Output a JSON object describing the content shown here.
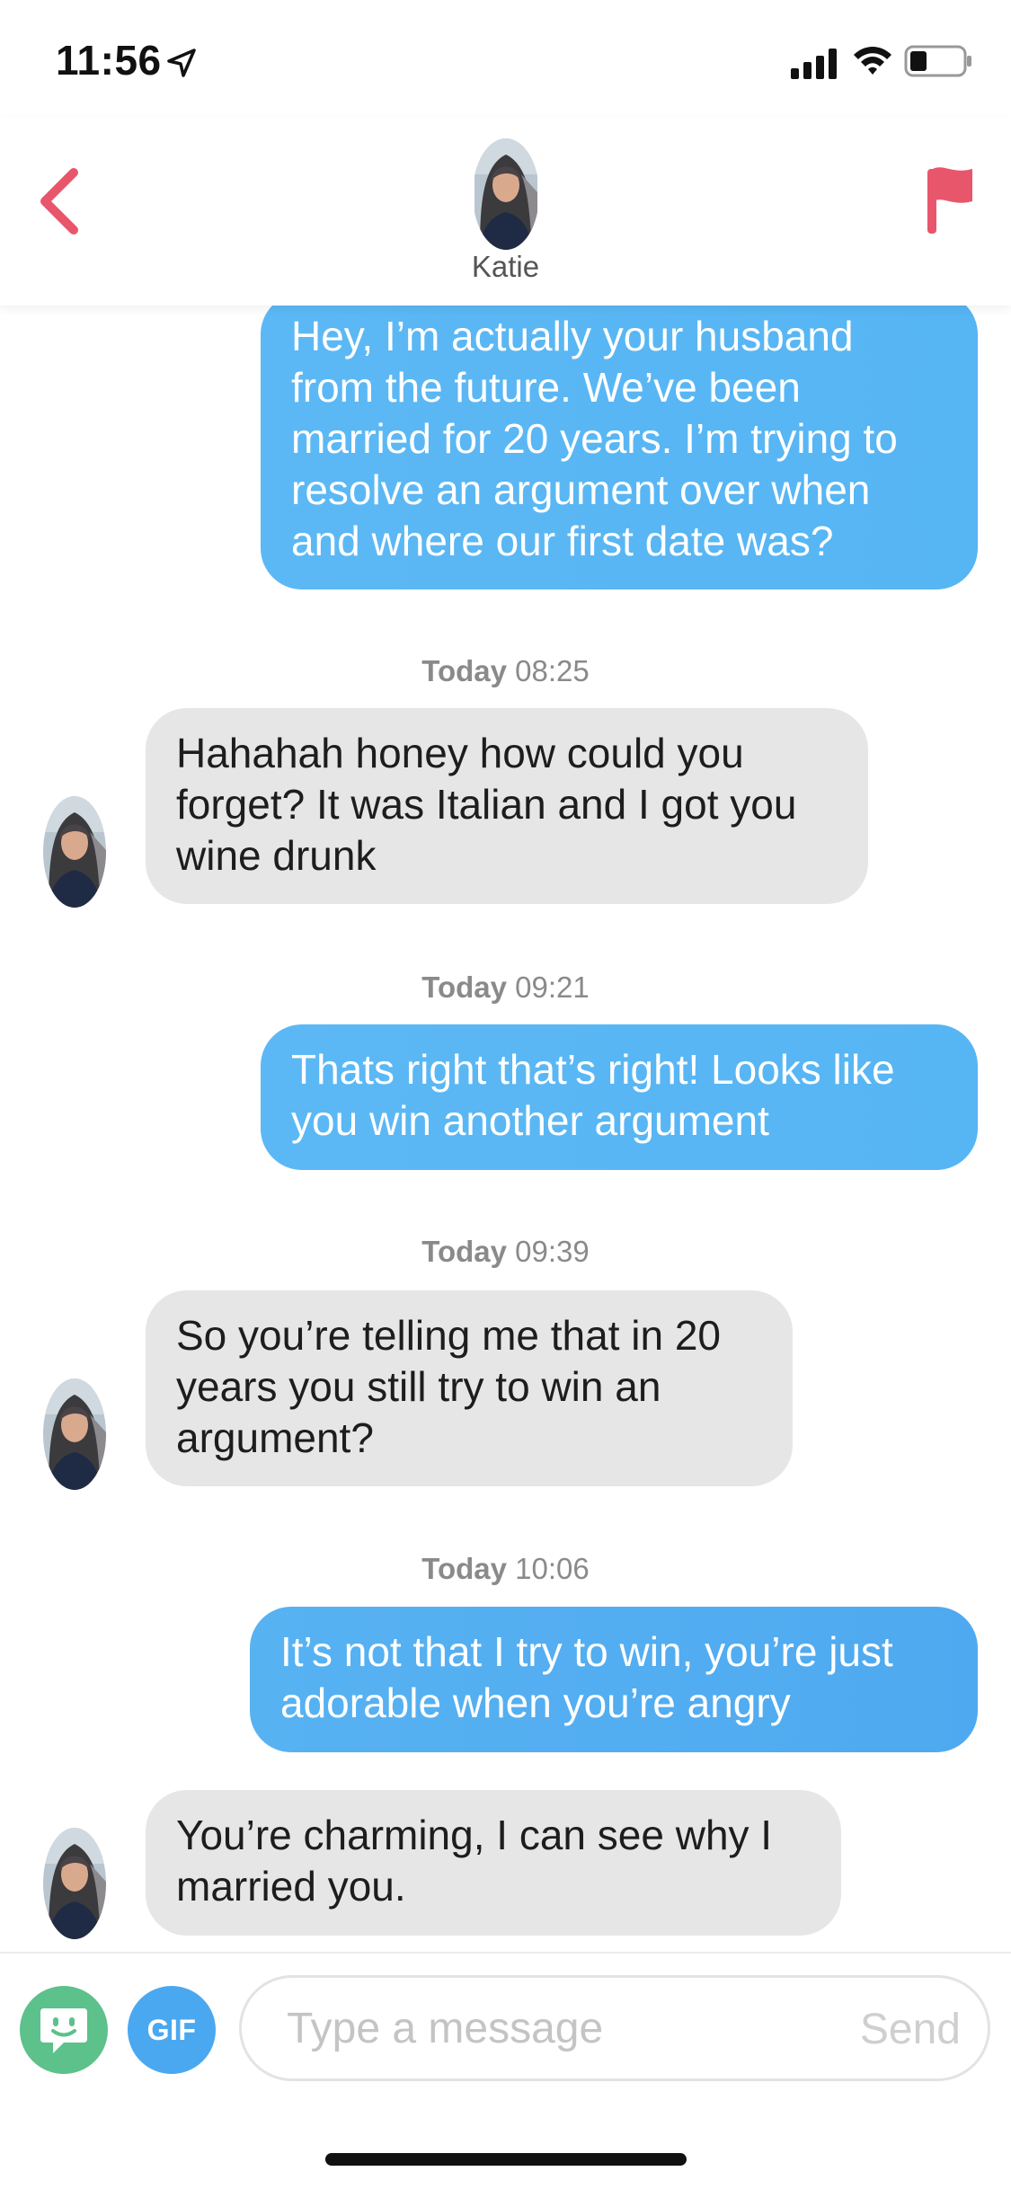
{
  "status_bar": {
    "time": "11:56",
    "icons": [
      "location-arrow-icon",
      "cellular-signal-icon",
      "wifi-icon",
      "battery-icon"
    ]
  },
  "header": {
    "contact_name": "Katie",
    "back_icon": "chevron-left-icon",
    "report_icon": "flag-icon",
    "accent_color": "#e8566c"
  },
  "messages": [
    {
      "direction": "sent",
      "lines": [
        "Hey, I’m actually your husband",
        "from the future. We’ve been",
        "married for 20 years. I’m trying to",
        "resolve an argument over when",
        "and where our first date was?"
      ]
    },
    {
      "direction": "received",
      "timestamp_day": "Today",
      "timestamp_time": "08:25",
      "lines": [
        "Hahahah honey how could you",
        "forget? It was Italian and I got you",
        "wine drunk"
      ]
    },
    {
      "direction": "sent",
      "timestamp_day": "Today",
      "timestamp_time": "09:21",
      "lines": [
        "Thats right that’s right! Looks like",
        "you win another argument"
      ]
    },
    {
      "direction": "received",
      "timestamp_day": "Today",
      "timestamp_time": "09:39",
      "lines": [
        "So you’re telling me that in 20",
        "years you still try to win an",
        "argument?"
      ]
    },
    {
      "direction": "sent",
      "timestamp_day": "Today",
      "timestamp_time": "10:06",
      "lines": [
        "It’s not that I try to win, you’re just",
        "adorable when you’re angry"
      ]
    },
    {
      "direction": "received",
      "lines": [
        "You’re charming, I can see why I",
        "married you."
      ]
    }
  ],
  "composer": {
    "sticker_icon": "smiley-sticker-icon",
    "gif_label": "GIF",
    "placeholder": "Type a message",
    "send_label": "Send"
  },
  "colors": {
    "sent_bubble": "#5cb8f5",
    "received_bubble": "#e6e6e6",
    "sticker_button": "#5cc18a",
    "gif_button": "#4aa8f0"
  }
}
